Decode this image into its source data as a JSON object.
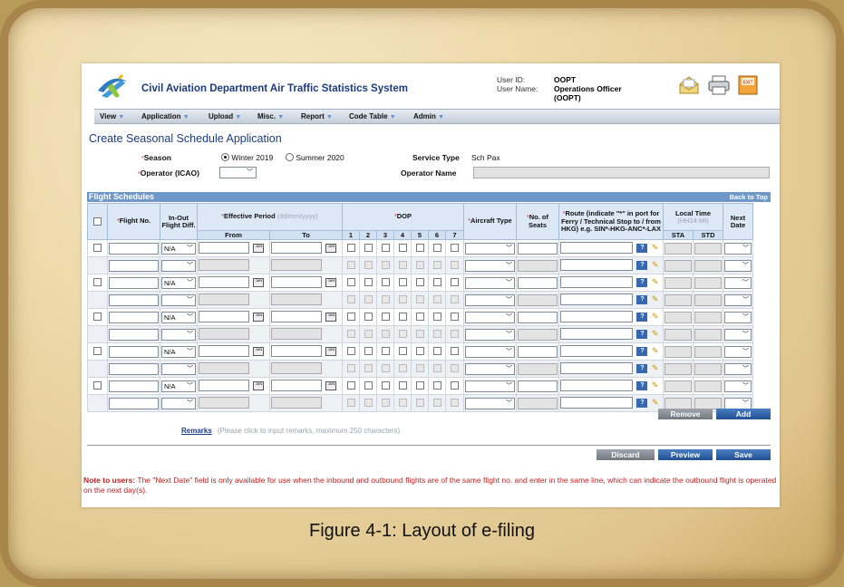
{
  "header": {
    "title": "Civil Aviation Department Air Traffic Statistics System",
    "user_id_label": "User ID:",
    "user_id": "OOPT",
    "user_name_label": "User Name:",
    "user_name": "Operations Officer (OOPT)",
    "exit_label": "EXIT"
  },
  "menu": [
    {
      "label": "View"
    },
    {
      "label": "Application"
    },
    {
      "label": "Upload"
    },
    {
      "label": "Misc."
    },
    {
      "label": "Report"
    },
    {
      "label": "Code Table"
    },
    {
      "label": "Admin"
    }
  ],
  "page_title": "Create Seasonal Schedule Application",
  "form": {
    "season_label": "Season",
    "season_options": [
      "Winter 2019",
      "Summer 2020"
    ],
    "season_selected": "Winter 2019",
    "service_type_label": "Service Type",
    "service_type_value": "Sch Pax",
    "operator_label": "Operator (ICAO)",
    "operator_name_label": "Operator Name",
    "required_mark": "*"
  },
  "grid": {
    "section_title": "Flight Schedules",
    "back_to_top": "Back to Top",
    "columns": {
      "flight_no": "Flight No.",
      "in_out": "In-Out Flight Diff.",
      "effective_period": "Effective Period",
      "effective_hint": "(dd/mm/yyyy)",
      "from": "From",
      "to": "To",
      "dop": "DOP",
      "dop_days": [
        "1",
        "2",
        "3",
        "4",
        "5",
        "6",
        "7"
      ],
      "aircraft_type": "Aircraft Type",
      "seats": "No. of Seats",
      "route": "Route (indicate \"*\" in port for Ferry / Technical Stop to / from HKG) e.g. SIN*-HKG-ANC*-LAX",
      "local_time": "Local Time",
      "local_time_hint": "(HH24:MI)",
      "sta": "STA",
      "std": "STD",
      "next_date": "Next Date"
    },
    "in_out_value": "N/A",
    "calendar_label": "JAN",
    "help_label": "?",
    "row_count": 10
  },
  "buttons": {
    "remove": "Remove",
    "add": "Add",
    "discard": "Discard",
    "preview": "Preview",
    "save": "Save"
  },
  "remarks": {
    "link": "Remarks",
    "hint": "(Please click to input remarks, maximum 250 characters)"
  },
  "note": {
    "prefix": "Note to users:",
    "text": "The \"Next Date\" field is only available for use when the inbound and outbound flights are of the same flight no. and enter in the same line, which can indicate the outbound flight is operated on the next day(s)."
  },
  "caption": "Figure 4-1: Layout of e-filing"
}
